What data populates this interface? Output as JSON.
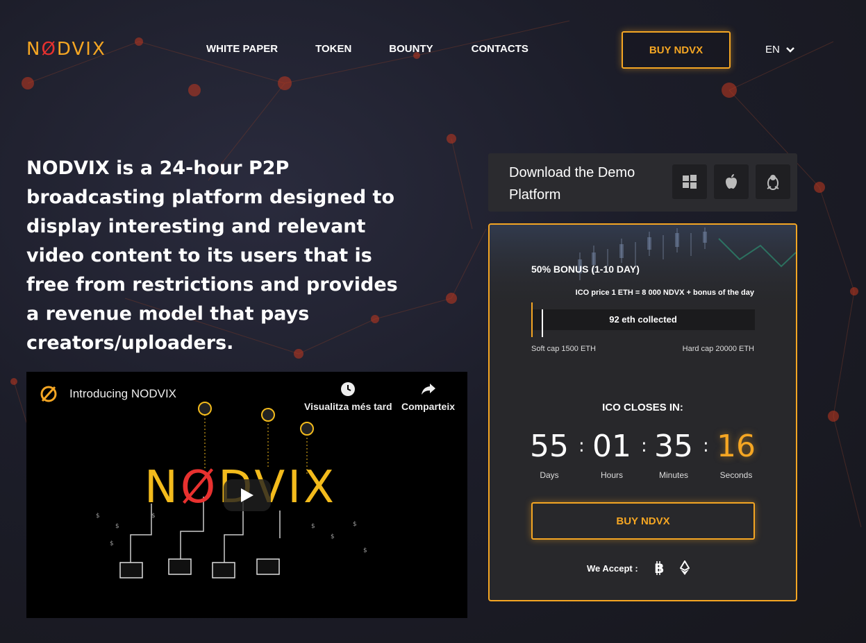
{
  "header": {
    "logo_text": "NODVIX",
    "nav": [
      "WHITE PAPER",
      "TOKEN",
      "BOUNTY",
      "CONTACTS"
    ],
    "buy_label": "BUY NDVX",
    "lang": "EN"
  },
  "hero": {
    "text": "NODVIX is a 24-hour P2P broadcasting platform designed to display interesting and relevant video content to its users that is free from restrictions and provides a revenue model that pays creators/uploaders."
  },
  "video": {
    "title": "Introducing NODVIX",
    "watch_later": "Visualitza més tard",
    "share": "Comparteix",
    "brand_text": "NODVIX"
  },
  "demo": {
    "text": "Download the Demo Platform",
    "icons": [
      "windows-icon",
      "apple-icon",
      "linux-icon"
    ]
  },
  "ico": {
    "bonus": "50% BONUS (1-10 DAY)",
    "price": "ICO price 1 ETH = 8 000 NDVX + bonus of the day",
    "collected": "92 eth collected",
    "soft_cap": "Soft cap 1500 ETH",
    "hard_cap": "Hard cap 20000 ETH",
    "closes_label": "ICO CLOSES IN:",
    "countdown": {
      "days": "55",
      "days_label": "Days",
      "hours": "01",
      "hours_label": "Hours",
      "minutes": "35",
      "minutes_label": "Minutes",
      "seconds": "16",
      "seconds_label": "Seconds"
    },
    "buy_label": "BUY NDVX",
    "accept_label": "We Accept :",
    "accept_icons": [
      "bitcoin-icon",
      "ethereum-icon"
    ]
  },
  "colors": {
    "accent": "#f5a623",
    "red": "#e8312f",
    "bg": "#1c1d29"
  }
}
